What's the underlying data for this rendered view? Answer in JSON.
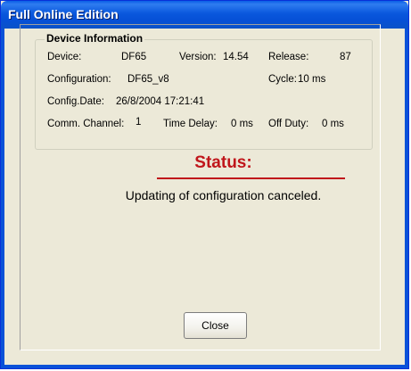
{
  "window": {
    "title": "Full Online Edition"
  },
  "device_info": {
    "legend": "Device Information",
    "device_label": "Device:",
    "device_value": "DF65",
    "version_label": "Version:",
    "version_value": "14.54",
    "release_label": "Release:",
    "release_value": "87",
    "configuration_label": "Configuration:",
    "configuration_value": "DF65_v8",
    "cycle_label": "Cycle:",
    "cycle_value": "10 ms",
    "config_date_label": "Config.Date:",
    "config_date_value": "26/8/2004 17:21:41",
    "comm_channel_label": "Comm. Channel:",
    "comm_channel_value": "1",
    "time_delay_label": "Time Delay:",
    "time_delay_value": "0 ms",
    "off_duty_label": "Off Duty:",
    "off_duty_value": "0 ms"
  },
  "status": {
    "title": "Status:",
    "message": "Updating of configuration canceled."
  },
  "buttons": {
    "close_label": "Close"
  },
  "colors": {
    "title_bar": "#0a58dd",
    "status_red": "#c0161b",
    "dialog_bg": "#ece9d8"
  }
}
